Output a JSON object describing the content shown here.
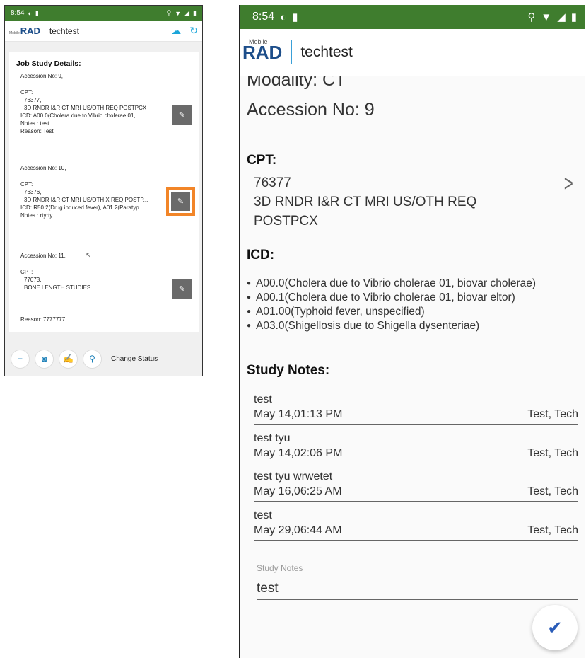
{
  "left": {
    "status": {
      "time": "8:54"
    },
    "app": {
      "logo": "RAD",
      "logo_small": "Mobile",
      "brand": "techtest"
    },
    "title": "Job Study Details:",
    "studies": [
      {
        "accession": "Accession No: 9,",
        "cpt_label": "CPT:",
        "cpt_code": "76377,",
        "cpt_desc": "3D RNDR I&R CT MRI US/OTH REQ POSTPCX",
        "icd": "ICD: A00.0(Cholera due to Vibrio cholerae 01,...",
        "notes": "Notes : test",
        "reason": "Reason: Test"
      },
      {
        "accession": "Accession No: 10,",
        "cpt_label": "CPT:",
        "cpt_code": "76376,",
        "cpt_desc": "3D RNDR I&R CT MRI US/OTH X REQ POSTP...",
        "icd": "ICD: R50.2(Drug induced fever), A01.2(Paratyp...",
        "notes": "Notes : rtyrty"
      },
      {
        "accession": "Accession No: 11,",
        "cpt_label": "CPT:",
        "cpt_code": "77073,",
        "cpt_desc": "BONE LENGTH STUDIES",
        "reason": "Reason: 7777777"
      }
    ],
    "bottom": {
      "change_status": "Change Status"
    }
  },
  "right": {
    "status": {
      "time": "8:54"
    },
    "app": {
      "logo": "RAD",
      "logo_small": "Mobile",
      "brand": "techtest"
    },
    "modality": "Modality: CT",
    "accession": "Accession No: 9",
    "cpt_heading": "CPT:",
    "cpt_code": "76377",
    "cpt_desc_1": "3D RNDR I&R CT MRI US/OTH REQ",
    "cpt_desc_2": "POSTPCX",
    "icd_heading": "ICD:",
    "icd_items": [
      "A00.0(Cholera due to Vibrio cholerae 01, biovar cholerae)",
      "A00.1(Cholera due to Vibrio cholerae 01, biovar eltor)",
      "A01.00(Typhoid fever, unspecified)",
      "A03.0(Shigellosis due to Shigella dysenteriae)"
    ],
    "notes_heading": "Study Notes:",
    "notes": [
      {
        "text": "test",
        "date": "May 14,01:13 PM",
        "author": "Test, Tech"
      },
      {
        "text": "test tyu",
        "date": "May 14,02:06 PM",
        "author": "Test, Tech"
      },
      {
        "text": "test tyu wrwetet",
        "date": "May 16,06:25 AM",
        "author": "Test, Tech"
      },
      {
        "text": "test",
        "date": "May 29,06:44 AM",
        "author": "Test, Tech"
      }
    ],
    "notes_field": {
      "placeholder": "Study Notes",
      "value": "test"
    }
  },
  "colors": {
    "status_bar": "#3f7d2e",
    "highlight": "#f28528",
    "accent": "#1aa5d9",
    "logo": "#1d4e8a",
    "fab_check": "#2a5cb8"
  },
  "icons": [
    "cloud-sync-icon",
    "refresh-icon",
    "edit-icon",
    "plus-icon",
    "camera-icon",
    "signature-icon",
    "location-icon",
    "chevron-right-icon",
    "check-icon"
  ]
}
